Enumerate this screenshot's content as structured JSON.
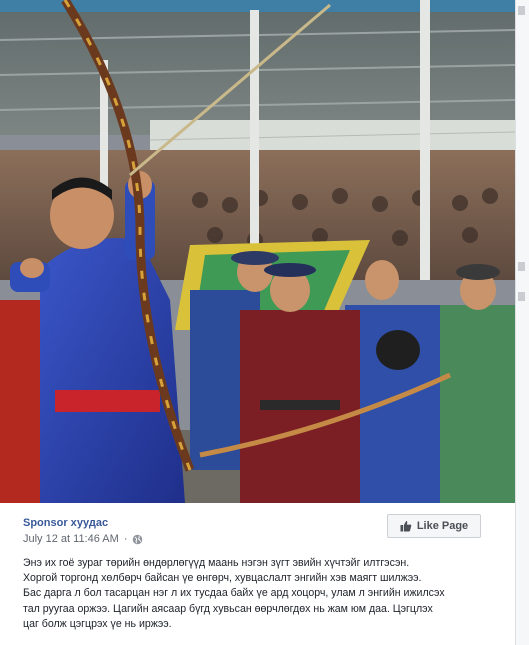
{
  "post": {
    "page_name": "Sponsor хуудас",
    "timestamp": "July 12 at 11:46 AM",
    "audience_icon": "globe-icon",
    "like_button": {
      "label": "Like Page",
      "icon": "thumbs-up-icon"
    },
    "caption_lines": [
      "Энэ их гоё зураг төрийн өндөрлөгүүд маань нэгэн зүгт эвийн хүчтэйг илтгэсэн.",
      "Хоргой торгонд хөлбөрч байсан үе өнгөрч, хувцаслалт энгийн хэв маягт шилжээ.",
      "Бас дарга л бол тасарцан нэг л их тусдаа байх үе ард хоцорч, улам л энгийн ижилсэх",
      "тал руугаа оржээ. Цагийн аясаар бүгд хувьсан өөрчлөгдөх нь жам юм даа. Цэгцлэх",
      "цаг болж цэгцрэх үе нь иржээ."
    ]
  },
  "colors": {
    "link_blue": "#385898",
    "meta_gray": "#616770",
    "text_dark": "#1d2129",
    "button_bg": "#f5f6f7",
    "page_bg": "#e9ebee"
  }
}
